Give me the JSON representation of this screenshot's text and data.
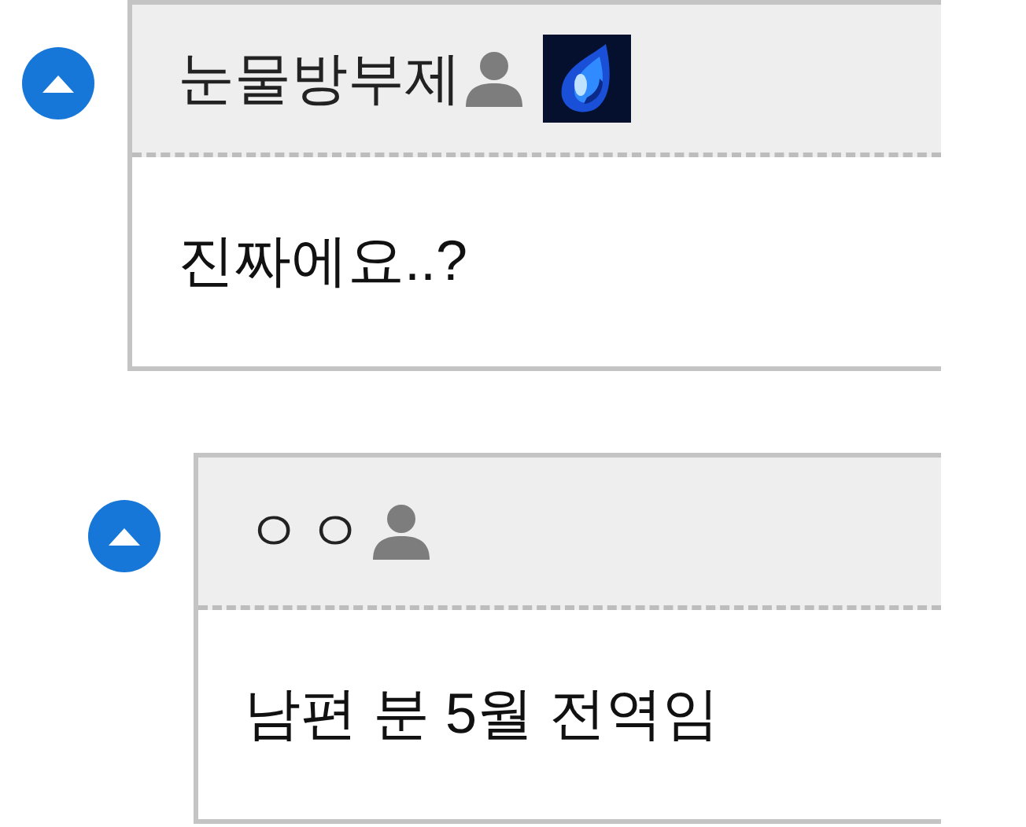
{
  "comments": [
    {
      "author": "눈물방부제",
      "has_badge": true,
      "text": "진짜에요..?",
      "children": [
        {
          "author": "ㅇㅇ",
          "has_badge": false,
          "text": "남편 분 5월 전역임"
        }
      ]
    }
  ]
}
